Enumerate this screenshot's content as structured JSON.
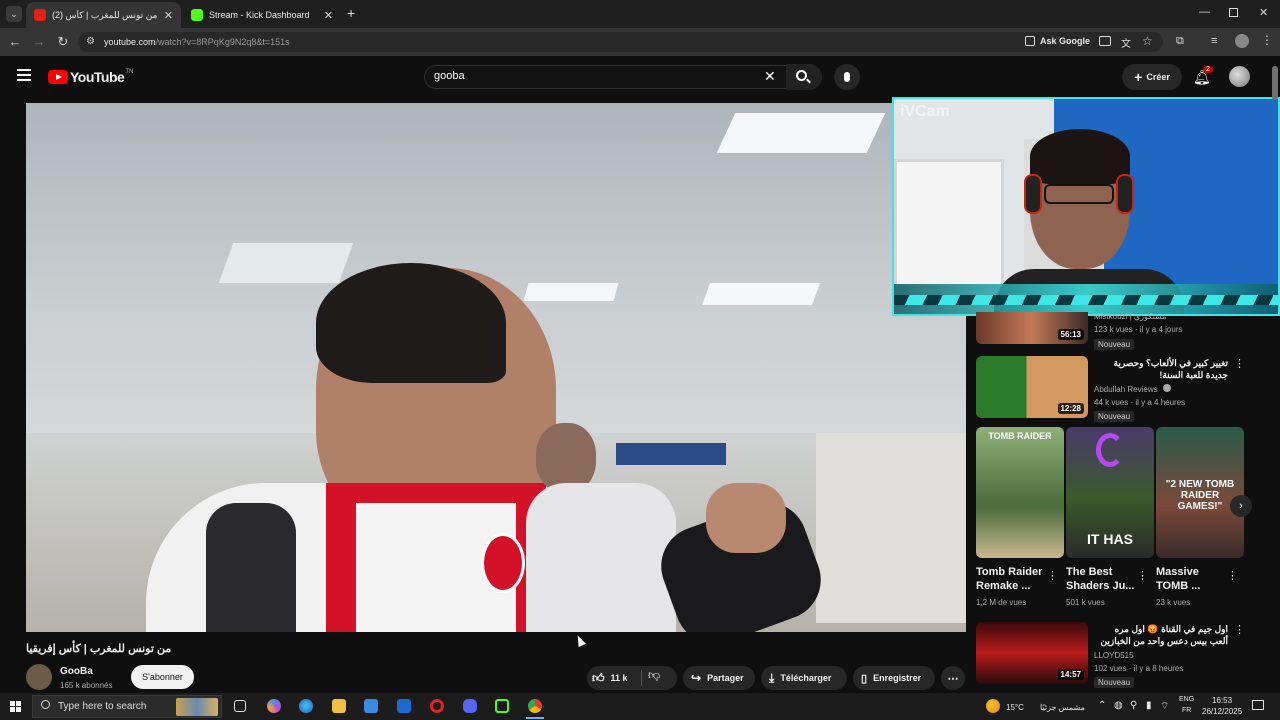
{
  "browser": {
    "tabs": [
      {
        "label": "(2) من تونس للمغرب | كأس",
        "favicon_color": "#e62117"
      },
      {
        "label": "Stream - Kick Dashboard",
        "favicon_color": "#53fc18"
      }
    ],
    "url_host": "youtube.com",
    "url_path": "/watch?v=8RPqKg9N2q8&t=151s",
    "ask_google": "Ask Google"
  },
  "youtube": {
    "logo_text": "YouTube",
    "logo_suffix": "TN",
    "search_value": "gooba",
    "create_label": "Créer",
    "notif_count": "2",
    "accent": "#ff0000"
  },
  "video": {
    "title": "من تونس للمغرب | كأس إفريقيا",
    "channel": "GooBa",
    "subscribers": "165 k abonnés",
    "subscribe_label": "S'abonner",
    "likes": "11 k",
    "share_label": "Partager",
    "download_label": "Télécharger",
    "save_label": "Enregistrer",
    "cam_watermark": "iVCam"
  },
  "sidebar": {
    "item1": {
      "channel": "Mistkouzi | مستكوزي",
      "meta": "123 k vues · il y a 4 jours",
      "badge": "Nouveau",
      "duration": "56:13"
    },
    "item2": {
      "title": "تغيير كبير في الألعاب؟ وحصرية جديدة للعبة السنة!",
      "channel": "Abdullah Reviews",
      "meta": "44 k vues · il y a 4 heures",
      "badge": "Nouveau",
      "duration": "12:28"
    },
    "shorts": [
      {
        "title": "Tomb Raider Remake ...",
        "views": "1,2 M de vues",
        "thumb_text": "TOMB RAIDER"
      },
      {
        "title": "The Best Shaders Ju...",
        "views": "501 k vues",
        "thumb_text": "IT HAS"
      },
      {
        "title": "Massive TOMB ...",
        "views": "23 k vues",
        "thumb_text": "\"2 NEW TOMB RAIDER GAMES!\""
      }
    ],
    "item3": {
      "title": "اول جيم في القناة 😡 اول مره ألعب بيس دعس واحد من الخبازين 😢 الى فالك غريب",
      "channel": "LLOYD515",
      "meta": "102 vues · il y a 8 heures",
      "badge": "Nouveau",
      "duration": "14:57"
    }
  },
  "taskbar": {
    "search_placeholder": "Type here to search",
    "weather": "15°C",
    "weather_text": "مشمس جزئيًا",
    "lang_top": "ENG",
    "lang_bottom": "FR",
    "time": "16:53",
    "date": "26/12/2025"
  }
}
